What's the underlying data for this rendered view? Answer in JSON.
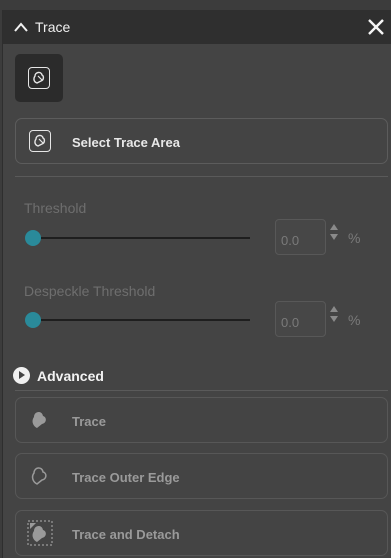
{
  "panel": {
    "title": "Trace",
    "collapse_icon": "chevron-up-icon",
    "close_icon": "close-icon"
  },
  "tool_tile": {
    "icon": "trace-area-icon"
  },
  "select_area_button": {
    "label": "Select Trace Area",
    "icon": "trace-area-icon"
  },
  "threshold": {
    "label": "Threshold",
    "value": "0.0",
    "unit": "%",
    "slider_level": 0
  },
  "despeckle": {
    "label": "Despeckle Threshold",
    "value": "0.0",
    "unit": "%",
    "slider_level": 0
  },
  "advanced": {
    "label": "Advanced",
    "icon": "expand-arrow-icon"
  },
  "actions": [
    {
      "label": "Trace",
      "icon": "trace-filled-icon"
    },
    {
      "label": "Trace Outer Edge",
      "icon": "trace-outline-icon"
    },
    {
      "label": "Trace and Detach",
      "icon": "trace-detach-icon"
    }
  ],
  "colors": {
    "accent": "#2a8a9a",
    "panel_bg": "#444444",
    "titlebar_bg": "#2f2f2f"
  }
}
